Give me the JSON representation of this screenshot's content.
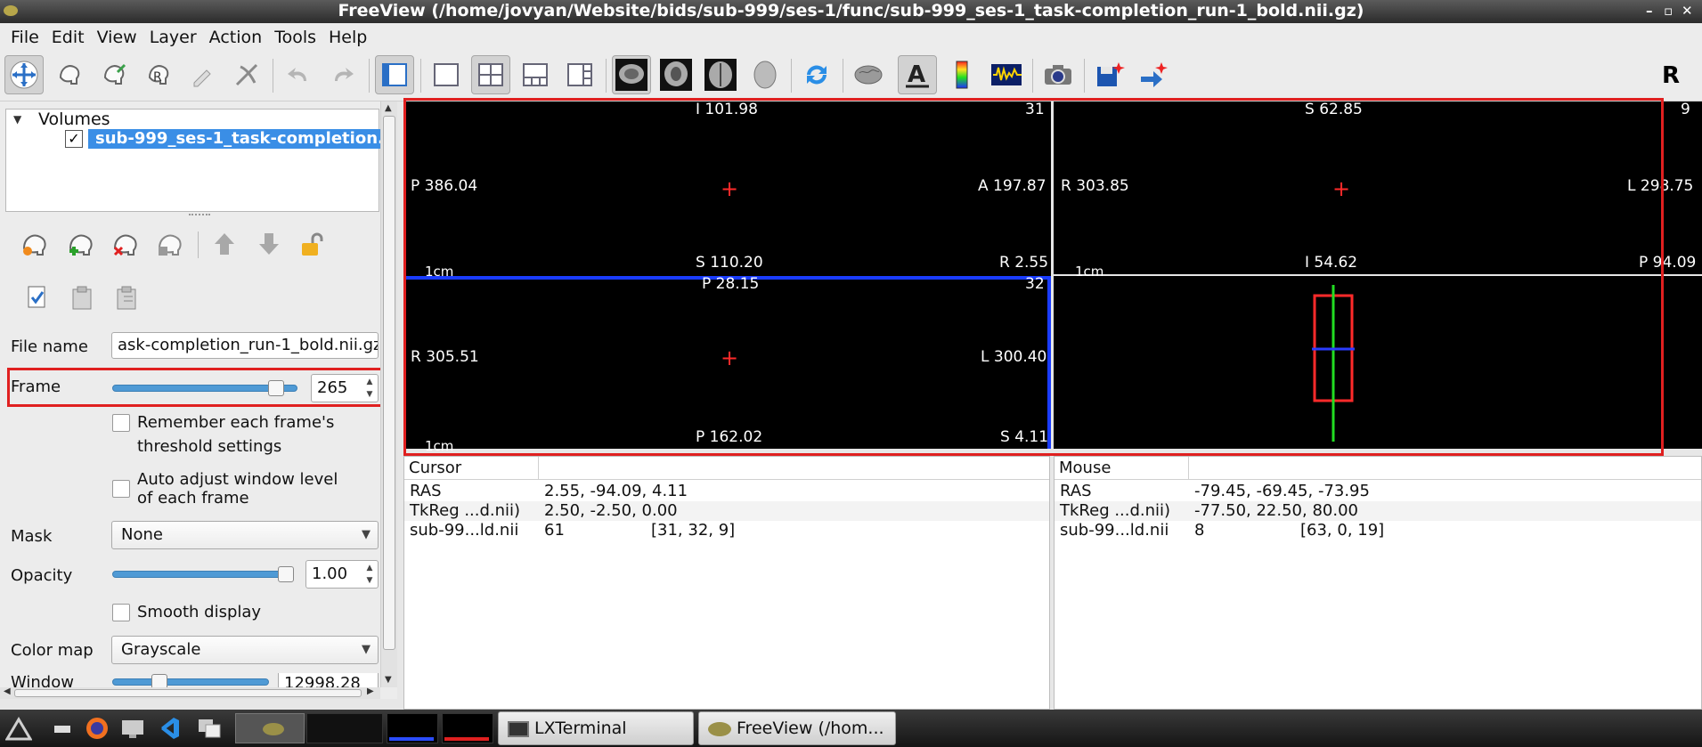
{
  "window": {
    "title": "FreeView (/home/jovyan/Website/bids/sub-999/ses-1/func/sub-999_ses-1_task-completion_run-1_bold.nii.gz)"
  },
  "menu": [
    "File",
    "Edit",
    "View",
    "Layer",
    "Action",
    "Tools",
    "Help"
  ],
  "toolbar": {
    "r_label": "R"
  },
  "layers": {
    "group_label": "Volumes",
    "item_label": "sub-999_ses-1_task-completion."
  },
  "props": {
    "file_name_label": "File name",
    "file_name_value": "ask-completion_run-1_bold.nii.gz",
    "frame_label": "Frame",
    "frame_value": "265",
    "frame_fraction": 0.92,
    "remember_line1": "Remember each frame's",
    "remember_line2": "threshold settings",
    "auto_line1": "Auto adjust window level",
    "auto_line2": "of each frame",
    "mask_label": "Mask",
    "mask_value": "None",
    "opacity_label": "Opacity",
    "opacity_value": "1.00",
    "smooth_label": "Smooth display",
    "colormap_label": "Color map",
    "colormap_value": "Grayscale",
    "window_label": "Window",
    "window_value": "12998.28"
  },
  "views": {
    "sagittal": {
      "top": "I 101.98",
      "slice": "31",
      "left": "P 386.04",
      "right": "A 197.87",
      "bottom": "S 110.20",
      "corner": "R 2.55",
      "scale": "1cm"
    },
    "coronal": {
      "top": "S 62.85",
      "slice": "9",
      "left": "R 303.85",
      "right": "L 298.75",
      "bottom": "I 54.62",
      "corner": "P 94.09",
      "scale": "1cm"
    },
    "axial": {
      "top": "P 28.15",
      "slice": "32",
      "left": "R 305.51",
      "right": "L 300.40",
      "bottom": "P 162.02",
      "corner": "S 4.11",
      "scale": "1cm"
    }
  },
  "cursor": {
    "header": "Cursor",
    "rows": [
      {
        "name": "RAS",
        "value": "2.55, -94.09, 4.11",
        "extra": ""
      },
      {
        "name": "TkReg ...d.nii)",
        "value": "2.50, -2.50, 0.00",
        "extra": ""
      },
      {
        "name": "sub-99...ld.nii",
        "value": "61",
        "extra": "[31, 32, 9]"
      }
    ]
  },
  "mouse": {
    "header": "Mouse",
    "rows": [
      {
        "name": "RAS",
        "value": "-79.45, -69.45, -73.95",
        "extra": ""
      },
      {
        "name": "TkReg ...d.nii)",
        "value": "-77.50, 22.50, 80.00",
        "extra": ""
      },
      {
        "name": "sub-99...ld.nii",
        "value": "8",
        "extra": "[63, 0, 19]"
      }
    ]
  },
  "taskbar": {
    "terminal_label": "LXTerminal",
    "freeview_label": "FreeView (/hom..."
  },
  "colors": {
    "accent": "#3a8ee6",
    "highlight": "#e02020",
    "view_bg": "#000000"
  }
}
